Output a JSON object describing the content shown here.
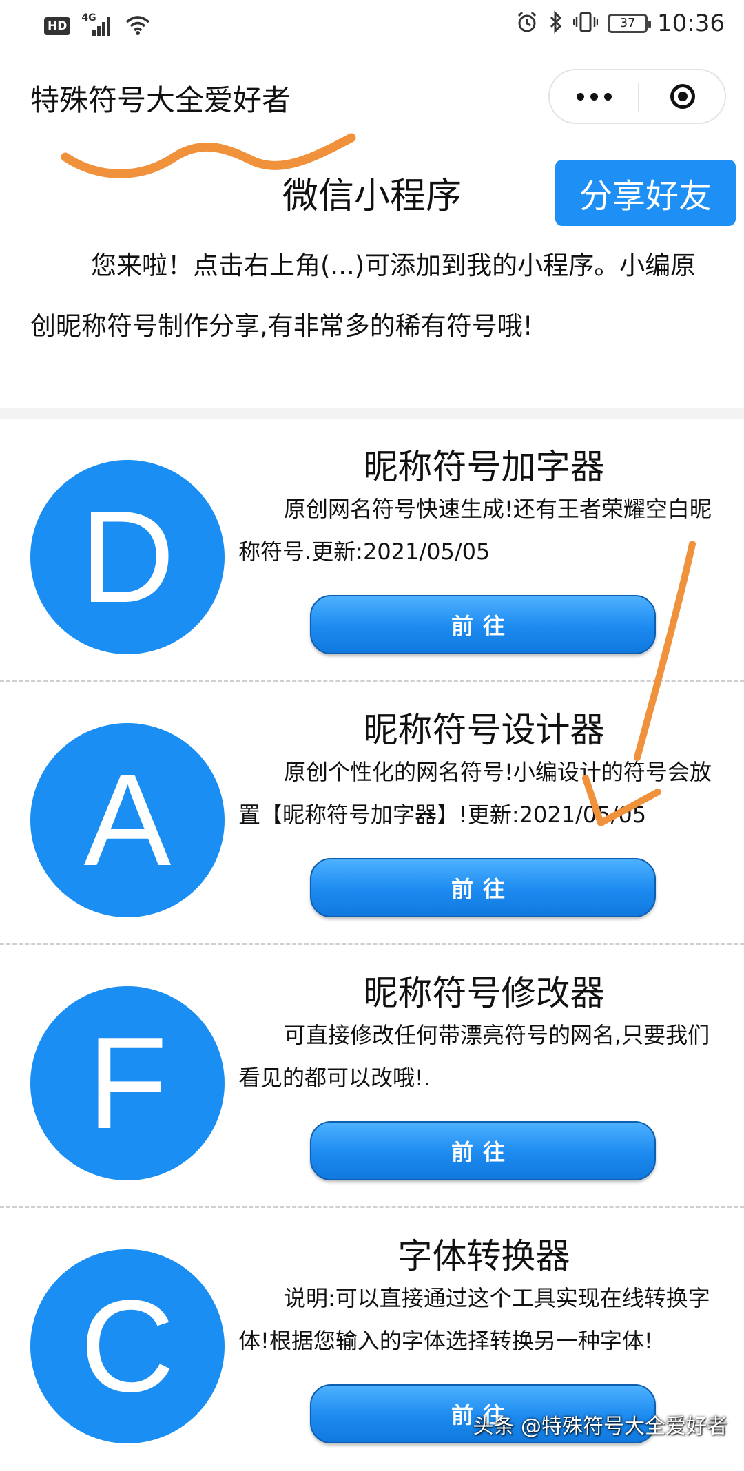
{
  "status_bar": {
    "hd": "HD",
    "network": "4G",
    "battery": "37",
    "time": "10:36"
  },
  "header": {
    "title": "特殊符号大全爱好者"
  },
  "intro": {
    "title": "微信小程序",
    "share_label": "分享好友",
    "text": "您来啦！点击右上角(...)可添加到我的小程序。小编原创昵称符号制作分享,有非常多的稀有符号哦!"
  },
  "tools": [
    {
      "letter": "D",
      "title": "昵称符号加字器",
      "desc": "原创网名符号快速生成!还有王者荣耀空白昵称符号.更新:2021/05/05",
      "button": "前往"
    },
    {
      "letter": "A",
      "title": "昵称符号设计器",
      "desc": "原创个性化的网名符号!小编设计的符号会放置【昵称符号加字器】!更新:2021/05/05",
      "button": "前往"
    },
    {
      "letter": "F",
      "title": "昵称符号修改器",
      "desc": "可直接修改任何带漂亮符号的网名,只要我们看见的都可以改哦!.",
      "button": "前往"
    },
    {
      "letter": "C",
      "title": "字体转换器",
      "desc": "说明:可以直接通过这个工具实现在线转换字体!根据您输入的字体选择转换另一种字体!",
      "button": "前往"
    }
  ],
  "watermark": "头条 @特殊符号大全爱好者",
  "colors": {
    "accent": "#1a8ef3",
    "share_button": "#1e90f5",
    "annotation": "#f0913c"
  },
  "icons": [
    "hd-icon",
    "signal-icon",
    "wifi-icon",
    "alarm-icon",
    "bluetooth-icon",
    "vibrate-icon",
    "battery-icon",
    "more-dots-icon",
    "close-target-icon"
  ]
}
